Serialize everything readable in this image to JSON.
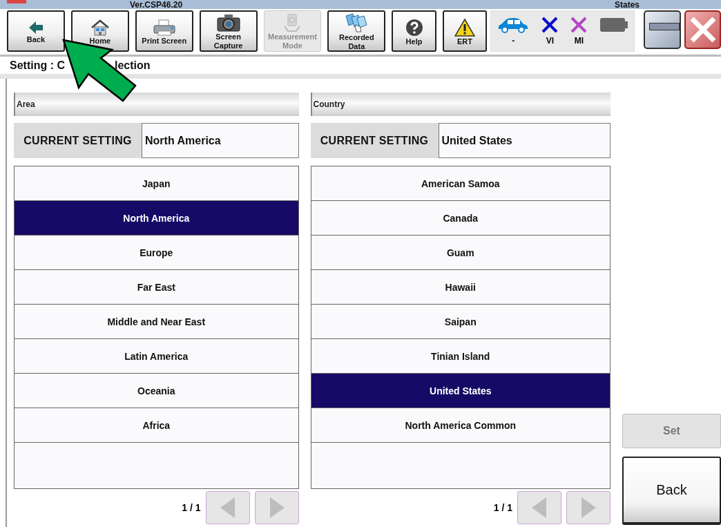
{
  "header": {
    "version": "Ver.CSP46.20",
    "states_label": "States"
  },
  "toolbar": [
    {
      "kind": "back",
      "lines": [
        "Back"
      ],
      "disabled": false
    },
    {
      "kind": "home",
      "lines": [
        "Home"
      ],
      "disabled": false
    },
    {
      "kind": "printer",
      "lines": [
        "Print Screen"
      ],
      "disabled": false
    },
    {
      "kind": "camera",
      "lines": [
        "Screen",
        "Capture"
      ],
      "disabled": false
    },
    {
      "kind": "meter",
      "lines": [
        "Measurement",
        "Mode"
      ],
      "disabled": true
    },
    {
      "kind": "folders",
      "lines": [
        "Recorded",
        "Data"
      ],
      "disabled": false
    },
    {
      "kind": "help",
      "lines": [
        "Help"
      ],
      "disabled": false
    },
    {
      "kind": "warning",
      "lines": [
        "ERT"
      ],
      "disabled": false
    }
  ],
  "status": [
    {
      "kind": "car",
      "label": "-"
    },
    {
      "kind": "cross",
      "color": "#0a0acc",
      "label": "VI"
    },
    {
      "kind": "cross",
      "color": "#b347c4",
      "label": "MI"
    },
    {
      "kind": "battery"
    }
  ],
  "page_title_parts": [
    "Setting : C",
    "lection"
  ],
  "panels": [
    {
      "header": "Area",
      "current_label": "CURRENT SETTING",
      "current_value": "North America",
      "page": "1 / 1",
      "items": [
        {
          "label": "Japan",
          "selected": false
        },
        {
          "label": "North America",
          "selected": true
        },
        {
          "label": "Europe",
          "selected": false
        },
        {
          "label": "Far East",
          "selected": false
        },
        {
          "label": "Middle and Near East",
          "selected": false
        },
        {
          "label": "Latin America",
          "selected": false
        },
        {
          "label": "Oceania",
          "selected": false
        },
        {
          "label": "Africa",
          "selected": false
        }
      ]
    },
    {
      "header": "Country",
      "current_label": "CURRENT SETTING",
      "current_value": "United States",
      "page": "1 / 1",
      "items": [
        {
          "label": "American Samoa",
          "selected": false
        },
        {
          "label": "Canada",
          "selected": false
        },
        {
          "label": "Guam",
          "selected": false
        },
        {
          "label": "Hawaii",
          "selected": false
        },
        {
          "label": "Saipan",
          "selected": false
        },
        {
          "label": "Tinian Island",
          "selected": false
        },
        {
          "label": "United States",
          "selected": true
        },
        {
          "label": "North America Common",
          "selected": false
        }
      ]
    }
  ],
  "side_buttons": [
    {
      "label": "Set",
      "disabled": true
    },
    {
      "label": "Back",
      "disabled": false
    }
  ]
}
